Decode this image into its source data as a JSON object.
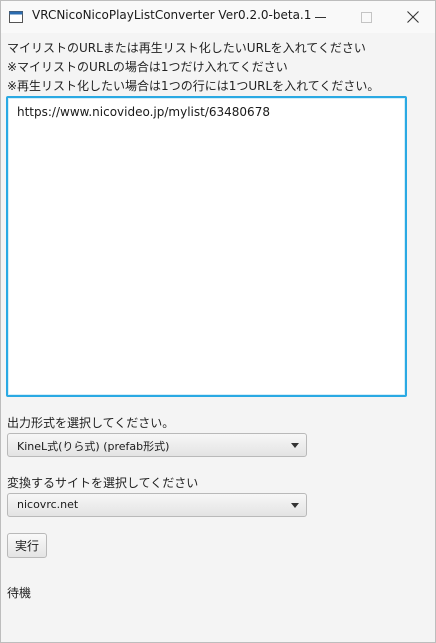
{
  "window": {
    "title": "VRCNicoNicoPlayListConverter Ver0.2.0-beta.1"
  },
  "instructions": {
    "line1": "マイリストのURLまたは再生リスト化したいURLを入れてください",
    "line2": "※マイリストのURLの場合は1つだけ入れてください",
    "line3": "※再生リスト化したい場合は1つの行には1つURLを入れてください。"
  },
  "url_input": {
    "value": "https://www.nicovideo.jp/mylist/63480678"
  },
  "output_format": {
    "label": "出力形式を選択してください。",
    "selected": "KineL式(りら式) (prefab形式)"
  },
  "site": {
    "label": "変換するサイトを選択してください",
    "selected": "nicovrc.net"
  },
  "run_button": {
    "label": "実行"
  },
  "status": {
    "text": "待機"
  },
  "icons": {
    "app": "app-window-icon",
    "minimize": "minimize-icon",
    "maximize": "maximize-icon",
    "close": "close-icon",
    "dropdown": "chevron-down-icon"
  }
}
